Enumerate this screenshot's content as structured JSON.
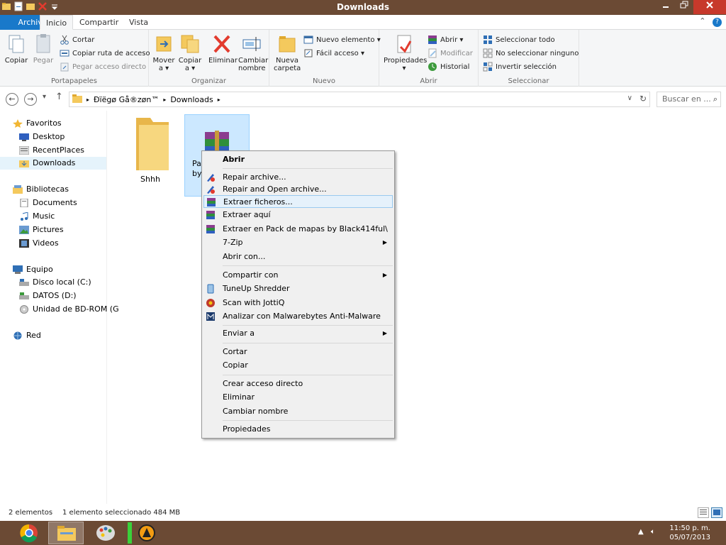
{
  "window": {
    "title": "Downloads",
    "minimize_icon": "minimize-icon",
    "maximize_icon": "restore-icon",
    "close_icon": "close-icon"
  },
  "ribbon_tabs": {
    "file": "Archivo",
    "home": "Inicio",
    "share": "Compartir",
    "view": "Vista"
  },
  "ribbon": {
    "clipboard": {
      "label": "Portapapeles",
      "copy": "Copiar",
      "paste": "Pegar",
      "cut": "Cortar",
      "copy_path": "Copiar ruta de acceso",
      "paste_shortcut": "Pegar acceso directo"
    },
    "organize": {
      "label": "Organizar",
      "move_to_l1": "Mover",
      "move_to_l2": "a ▾",
      "copy_to_l1": "Copiar",
      "copy_to_l2": "a ▾",
      "delete": "Eliminar",
      "rename_l1": "Cambiar",
      "rename_l2": "nombre"
    },
    "new": {
      "label": "Nuevo",
      "new_folder_l1": "Nueva",
      "new_folder_l2": "carpeta",
      "new_item": "Nuevo elemento ▾",
      "easy_access": "Fácil acceso ▾"
    },
    "open": {
      "label": "Abrir",
      "properties": "Propiedades",
      "open": "Abrir ▾",
      "edit": "Modificar",
      "history": "Historial"
    },
    "select": {
      "label": "Seleccionar",
      "select_all": "Seleccionar todo",
      "select_none": "No seleccionar ninguno",
      "invert": "Invertir selección"
    }
  },
  "address": {
    "crumb_user": "Ðïëgø Gå®zøn™",
    "crumb_folder": "Downloads",
    "search_placeholder": "Buscar en ..."
  },
  "navpane": {
    "favorites": "Favoritos",
    "desktop": "Desktop",
    "recent": "RecentPlaces",
    "downloads": "Downloads",
    "libraries": "Bibliotecas",
    "documents": "Documents",
    "music": "Music",
    "pictures": "Pictures",
    "videos": "Videos",
    "computer": "Equipo",
    "local_c": "Disco local (C:)",
    "datos_d": "DATOS (D:)",
    "bdrom": "Unidad de BD-ROM (G",
    "network": "Red"
  },
  "files": [
    {
      "name": "Shhh"
    },
    {
      "name_l1": "Pa",
      "name_l2": "by"
    }
  ],
  "context_menu": {
    "open": "Abrir",
    "repair": "Repair archive...",
    "repair_open": "Repair and Open archive...",
    "extract_files": "Extraer ficheros...",
    "extract_here": "Extraer aquí",
    "extract_to": "Extraer en Pack de mapas by Black414ful\\",
    "zip7": "7-Zip",
    "open_with": "Abrir con...",
    "share_with": "Compartir con",
    "tuneup": "TuneUp Shredder",
    "jotti": "Scan with JottiQ",
    "malwarebytes": "Analizar con Malwarebytes Anti-Malware",
    "send_to": "Enviar a",
    "cut": "Cortar",
    "copy": "Copiar",
    "create_shortcut": "Crear acceso directo",
    "delete": "Eliminar",
    "rename": "Cambiar nombre",
    "properties": "Propiedades"
  },
  "status": {
    "count": "2 elementos",
    "selected": "1 elemento seleccionado  484 MB"
  },
  "taskbar": {
    "time": "11:50 p. m.",
    "date": "05/07/2013"
  },
  "colors": {
    "titlebar": "#6b4a34",
    "file_tab": "#1979ca",
    "selection": "#cce8ff",
    "close": "#c7392b"
  }
}
